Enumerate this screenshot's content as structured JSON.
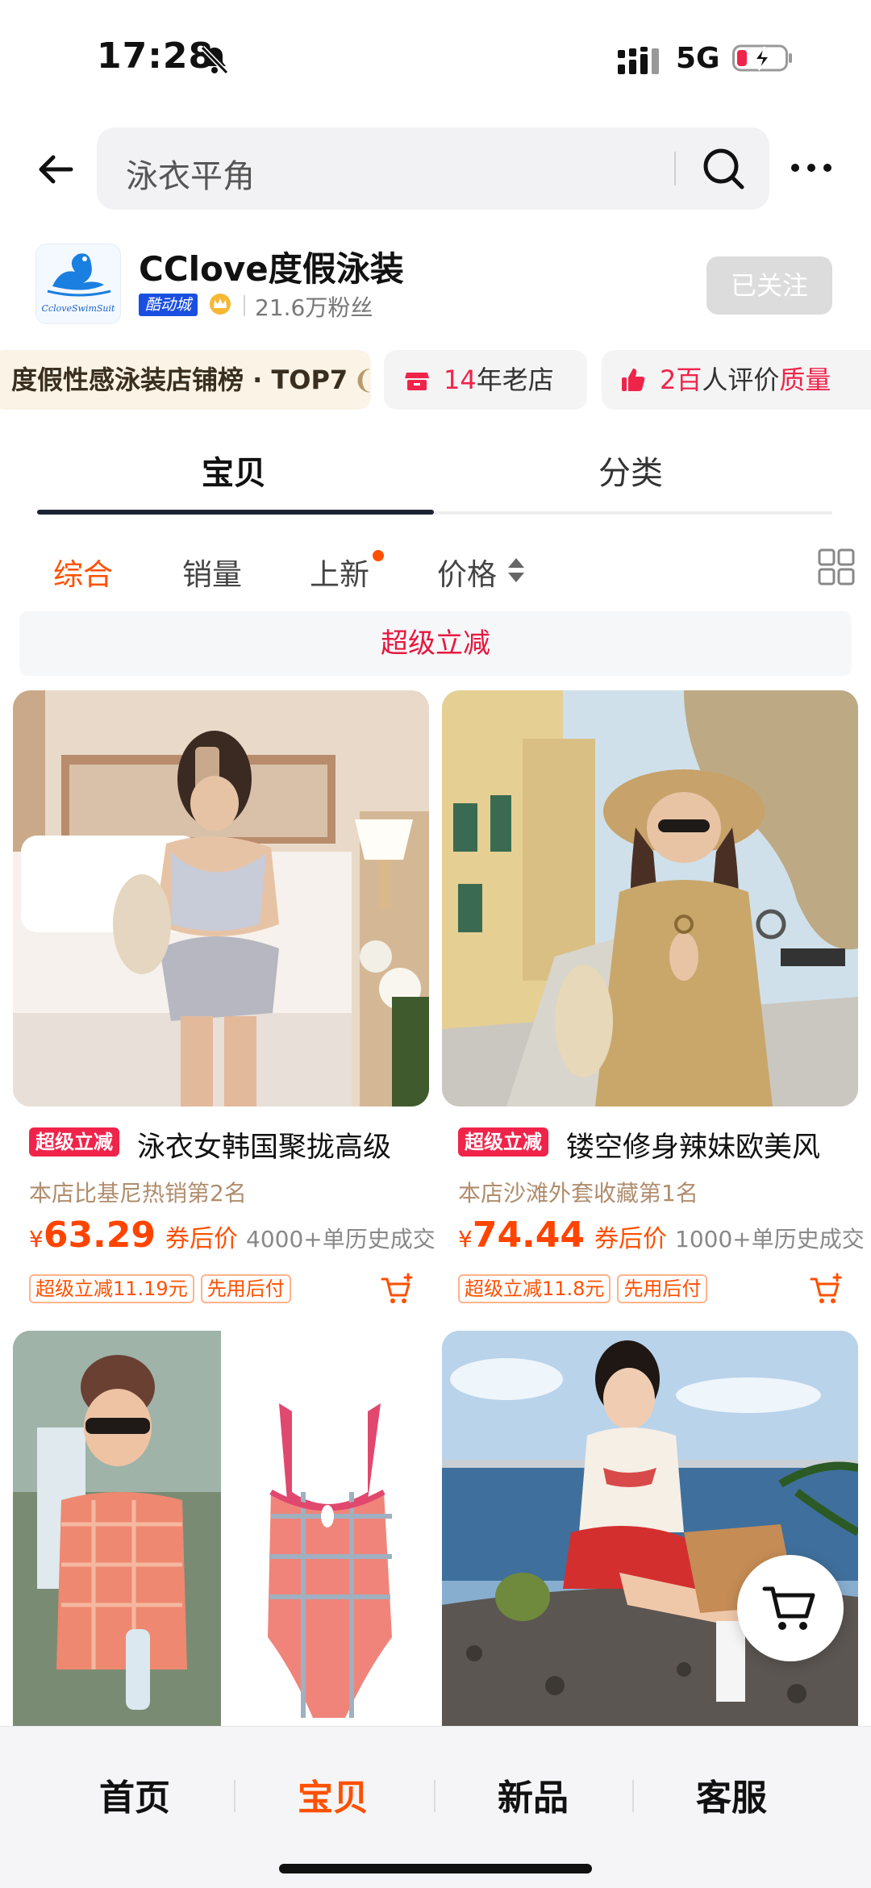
{
  "status_bar": {
    "time": "17:28",
    "network": "5G"
  },
  "search": {
    "query": "泳衣平角"
  },
  "shop": {
    "logo_text": "CcloveSwimSuit",
    "name": "CClove度假泳装",
    "badge": "酷动城",
    "fans": "21.6万粉丝",
    "follow_label": "已关注"
  },
  "tags": {
    "rank": "度假性感泳装店铺榜 · TOP7",
    "old_store_num": "14",
    "old_store_text": "年老店",
    "review_num": "2百",
    "review_text": "人评价",
    "review_quality": "质量"
  },
  "tabs": {
    "items": "宝贝",
    "categories": "分类"
  },
  "sort": {
    "general": "综合",
    "sales": "销量",
    "new": "上新",
    "price": "价格"
  },
  "promo_banner": "超级立减",
  "products": [
    {
      "super_tag": "超级立减",
      "title": "泳衣女韩国聚拢高级",
      "rank": "本店比基尼热销第2名",
      "currency": "¥",
      "price": "63.29",
      "price_note": "券后价",
      "sold": "4000+单历史成交",
      "coupon": "超级立减11.19元",
      "pay_later": "先用后付"
    },
    {
      "super_tag": "超级立减",
      "title": "镂空修身辣妹欧美风",
      "rank": "本店沙滩外套收藏第1名",
      "currency": "¥",
      "price": "74.44",
      "price_note": "券后价",
      "sold": "1000+单历史成交",
      "coupon": "超级立减11.8元",
      "pay_later": "先用后付"
    }
  ],
  "bottom_nav": {
    "home": "首页",
    "items": "宝贝",
    "new": "新品",
    "service": "客服"
  },
  "colors": {
    "accent": "#ff5000",
    "promo_red": "#f0244b",
    "tab_indicator": "#1c2433"
  }
}
